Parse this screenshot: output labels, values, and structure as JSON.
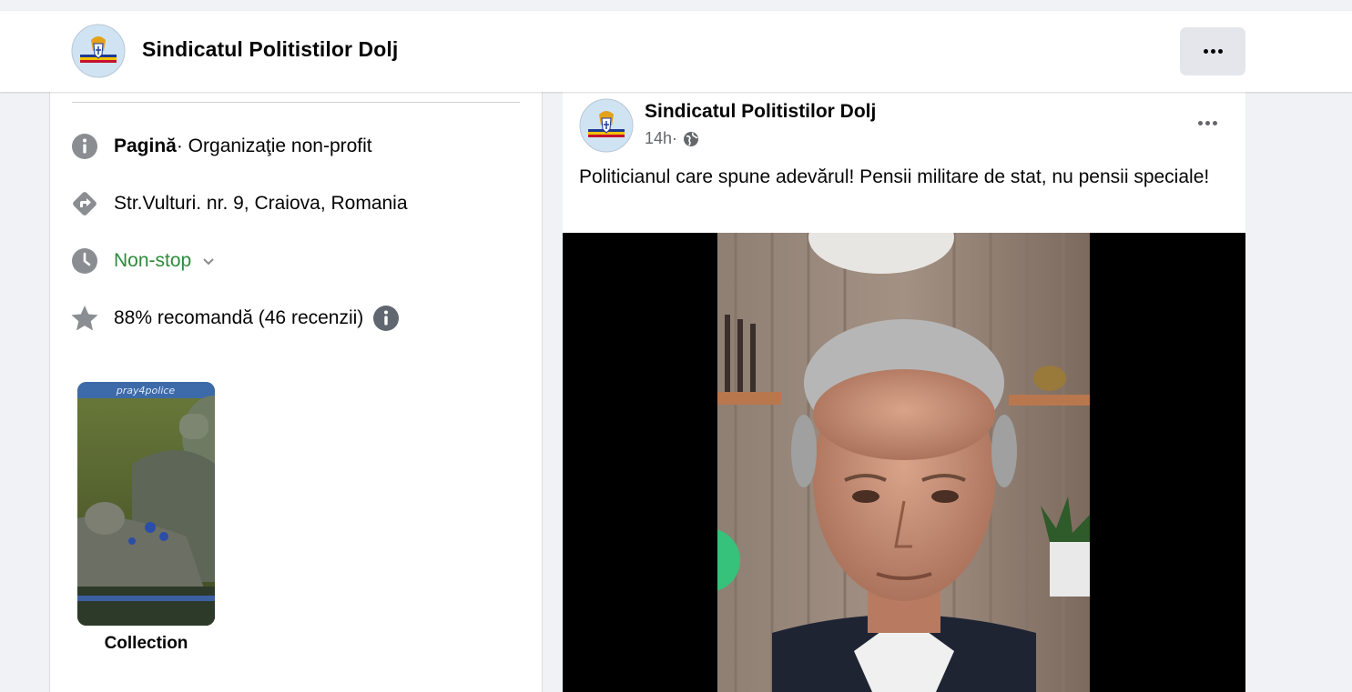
{
  "header": {
    "page_name": "Sindicatul Politistilor Dolj",
    "more_icon": "more-horizontal-icon"
  },
  "intro": {
    "category_bold": "Pagină",
    "category_rest": " · Organizaţie non-profit",
    "address": "Str.Vulturi. nr. 9, Craiova, Romania",
    "hours": "Non-stop",
    "rating": "88% recomandă (46 recenzii)",
    "collection_label": "Collection",
    "collection_caption": "pray4police"
  },
  "post": {
    "author": "Sindicatul Politistilor Dolj",
    "time": "14h",
    "separator": " · ",
    "text": "Politicianul care spune adevărul! Pensii militare de stat, nu pensii speciale!"
  },
  "colors": {
    "accent_green": "#2e8b3a",
    "secondary_text": "#65676b",
    "icon_gray": "#8a8d91"
  }
}
